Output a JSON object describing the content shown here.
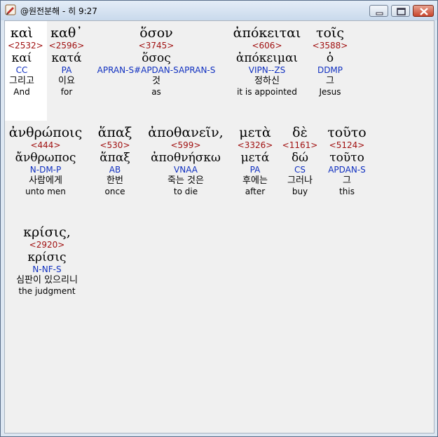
{
  "window": {
    "title": "@원전분해 - 히 9:27",
    "icons": {
      "app": "bible-app-icon",
      "minimize": "minimize-icon",
      "maximize": "maximize-icon",
      "close": "close-icon"
    }
  },
  "colors": {
    "strong": "#a01010",
    "parse": "#1030c0",
    "highlight": "#ffffff"
  },
  "words": [
    {
      "greek": "καὶ",
      "strong": "<2532>",
      "lemma": "καί",
      "parse": "CC",
      "korean": "그리고",
      "english": "And"
    },
    {
      "greek": "καθ᾽",
      "strong": "<2596>",
      "lemma": "κατά",
      "parse": "PA",
      "korean": "이요",
      "english": "for"
    },
    {
      "greek": "ὅσον",
      "strong": "<3745>",
      "lemma": "ὅσος",
      "parse": "APRAN-S#APDAN-SAPRAN-S",
      "korean": "것",
      "english": "as"
    },
    {
      "greek": "ἀπόκειται",
      "strong": "<606>",
      "lemma": "ἀπόκειμαι",
      "parse": "VIPN--ZS",
      "korean": "정하신",
      "english": "it is appointed"
    },
    {
      "greek": "τοῖς",
      "strong": "<3588>",
      "lemma": "ὁ",
      "parse": "DDMP",
      "korean": "그",
      "english": "Jesus"
    },
    {
      "greek": "ἀνθρώποις",
      "strong": "<444>",
      "lemma": "ἄνθρωπος",
      "parse": "N-DM-P",
      "korean": "사람에게",
      "english": "unto men"
    },
    {
      "greek": "ἅπαξ",
      "strong": "<530>",
      "lemma": "ἅπαξ",
      "parse": "AB",
      "korean": "한번",
      "english": "once"
    },
    {
      "greek": "ἀποθανεῖν,",
      "strong": "<599>",
      "lemma": "ἀποθνήσκω",
      "parse": "VNAA",
      "korean": "죽는 것은",
      "english": "to die"
    },
    {
      "greek": "μετὰ",
      "strong": "<3326>",
      "lemma": "μετά",
      "parse": "PA",
      "korean": "후에는",
      "english": "after"
    },
    {
      "greek": "δὲ",
      "strong": "<1161>",
      "lemma": "δώ",
      "parse": "CS",
      "korean": "그러나",
      "english": "buy"
    },
    {
      "greek": "τοῦτο",
      "strong": "<5124>",
      "lemma": "τοῦτο",
      "parse": "APDAN-S",
      "korean": "그",
      "english": "this"
    },
    {
      "greek": "κρίσις,",
      "strong": "<2920>",
      "lemma": "κρίσις",
      "parse": "N-NF-S",
      "korean": "심판이 있으리니",
      "english": "the judgment"
    }
  ]
}
